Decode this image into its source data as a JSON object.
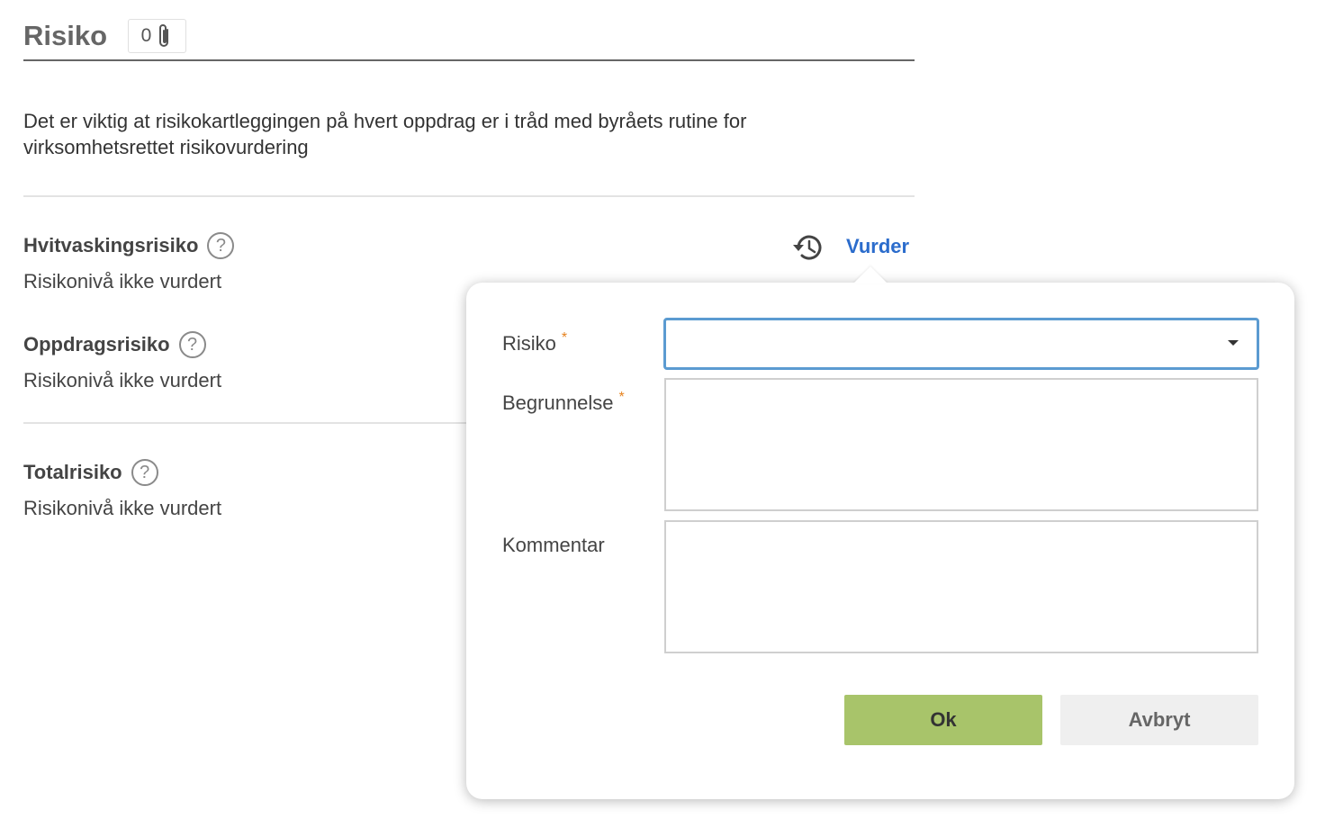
{
  "header": {
    "title": "Risiko",
    "attachment_count": "0"
  },
  "intro_text": "Det er viktig at risikokartleggingen på hvert oppdrag er i tråd med byråets rutine for virksomhetsrettet risikovurdering",
  "risks": [
    {
      "title": "Hvitvaskingsrisiko",
      "status": "Risikonivå ikke vurdert"
    },
    {
      "title": "Oppdragsrisiko",
      "status": "Risikonivå ikke vurdert"
    },
    {
      "title": "Totalrisiko",
      "status": "Risikonivå ikke vurdert"
    }
  ],
  "help_glyph": "?",
  "vurder_label": "Vurder",
  "popover": {
    "risiko_label": "Risiko",
    "risiko_value": "",
    "begrunnelse_label": "Begrunnelse",
    "kommentar_label": "Kommentar",
    "required_marker": "*",
    "ok_label": "Ok",
    "cancel_label": "Avbryt"
  },
  "colors": {
    "link": "#2b6ccc",
    "ok_button": "#a8c46a",
    "cancel_button": "#efefef",
    "required": "#e6821e",
    "focus_border": "#5b9bd1"
  },
  "icons": {
    "attachment": "paperclip-icon",
    "help": "question-circle-icon",
    "history": "history-icon",
    "select_caret": "caret-down-icon"
  }
}
